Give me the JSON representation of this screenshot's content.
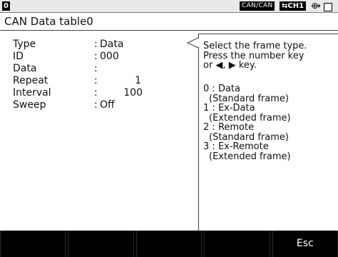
{
  "status": {
    "page_number": "0",
    "mode": "CAN∕CAN",
    "channel": "⇆CH1",
    "connector_icon": "plug-icon",
    "window_icon": "square-icon"
  },
  "title": "CAN Data table0",
  "params": {
    "type": {
      "label": "Type",
      "value": "Data"
    },
    "id": {
      "label": "ID",
      "value": "000"
    },
    "data": {
      "label": "Data",
      "value": ""
    },
    "repeat": {
      "label": "Repeat",
      "value": "1"
    },
    "interval": {
      "label": "Interval",
      "value": "100"
    },
    "sweep": {
      "label": "Sweep",
      "value": "Off"
    }
  },
  "help": {
    "line1": "Select the frame type.",
    "line2": "Press the number key",
    "line3": "or ◀, ▶ key."
  },
  "options": [
    {
      "key": "0",
      "name": "Data",
      "desc": "(Standard frame)"
    },
    {
      "key": "1",
      "name": "Ex-Data",
      "desc": "(Extended frame)"
    },
    {
      "key": "2",
      "name": "Remote",
      "desc": "(Standard frame)"
    },
    {
      "key": "3",
      "name": "Ex-Remote",
      "desc": "(Extended frame)"
    }
  ],
  "fkeys": [
    "",
    "",
    "",
    "",
    "Esc"
  ]
}
